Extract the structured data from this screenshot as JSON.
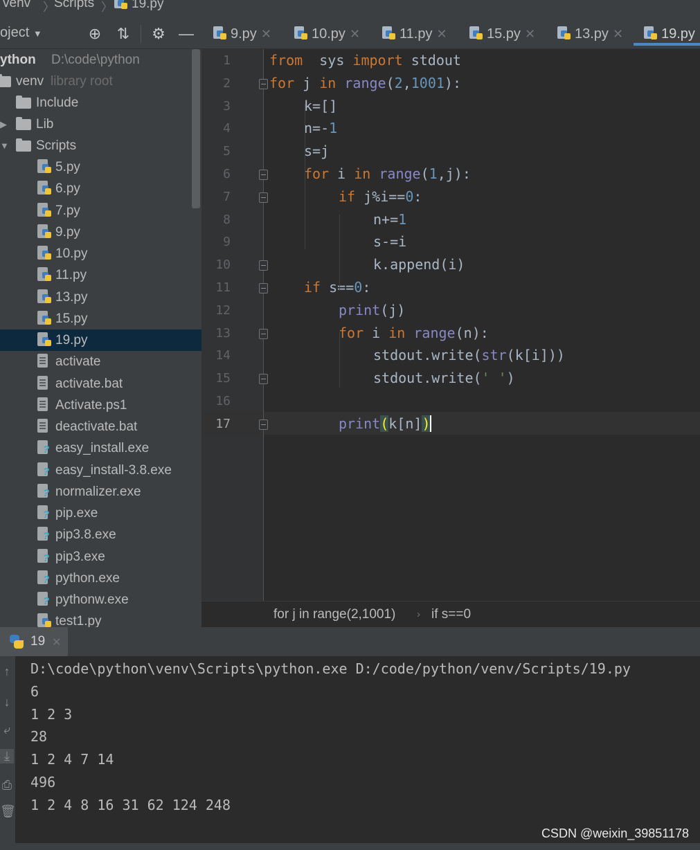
{
  "breadcrumb": {
    "items": [
      "venv",
      "Scripts",
      "19.py"
    ]
  },
  "project_toolbar": {
    "label": "oject",
    "icons": [
      "locate-icon",
      "collapse-icon",
      "gear-icon",
      "minimize-icon"
    ]
  },
  "tabs": [
    {
      "label": "9.py",
      "active": false
    },
    {
      "label": "10.py",
      "active": false
    },
    {
      "label": "11.py",
      "active": false
    },
    {
      "label": "15.py",
      "active": false
    },
    {
      "label": "13.py",
      "active": false
    },
    {
      "label": "19.py",
      "active": true
    }
  ],
  "sidebar": {
    "root": {
      "name": "ython",
      "path": "D:\\code\\python"
    },
    "venv": {
      "name": "venv",
      "hint": "library root"
    },
    "folders": [
      "Include",
      "Lib",
      "Scripts"
    ],
    "files": [
      {
        "name": "5.py",
        "kind": "python"
      },
      {
        "name": "6.py",
        "kind": "python"
      },
      {
        "name": "7.py",
        "kind": "python"
      },
      {
        "name": "9.py",
        "kind": "python"
      },
      {
        "name": "10.py",
        "kind": "python"
      },
      {
        "name": "11.py",
        "kind": "python"
      },
      {
        "name": "13.py",
        "kind": "python"
      },
      {
        "name": "15.py",
        "kind": "python"
      },
      {
        "name": "19.py",
        "kind": "python",
        "selected": true
      },
      {
        "name": "activate",
        "kind": "text"
      },
      {
        "name": "activate.bat",
        "kind": "text"
      },
      {
        "name": "Activate.ps1",
        "kind": "text"
      },
      {
        "name": "deactivate.bat",
        "kind": "text"
      },
      {
        "name": "easy_install.exe",
        "kind": "exe"
      },
      {
        "name": "easy_install-3.8.exe",
        "kind": "exe"
      },
      {
        "name": "normalizer.exe",
        "kind": "exe"
      },
      {
        "name": "pip.exe",
        "kind": "exe"
      },
      {
        "name": "pip3.8.exe",
        "kind": "exe"
      },
      {
        "name": "pip3.exe",
        "kind": "exe"
      },
      {
        "name": "python.exe",
        "kind": "exe"
      },
      {
        "name": "pythonw.exe",
        "kind": "exe"
      },
      {
        "name": "test1.py",
        "kind": "python"
      }
    ]
  },
  "editor": {
    "line_numbers": [
      "1",
      "2",
      "3",
      "4",
      "5",
      "6",
      "7",
      "8",
      "9",
      "10",
      "11",
      "12",
      "13",
      "14",
      "15",
      "16",
      "17"
    ],
    "current_line": "17",
    "lines": [
      [
        [
          "kw",
          "from"
        ],
        [
          "",
          "  sys "
        ],
        [
          "kw",
          "import"
        ],
        [
          "",
          " stdout"
        ]
      ],
      [
        [
          "kw",
          "for"
        ],
        [
          "",
          " j "
        ],
        [
          "kw",
          "in"
        ],
        [
          "",
          " "
        ],
        [
          "bi",
          "range"
        ],
        [
          "",
          "("
        ],
        [
          "num",
          "2"
        ],
        [
          "",
          ","
        ],
        [
          "num",
          "1001"
        ],
        [
          "",
          "):"
        ]
      ],
      [
        [
          "",
          "k=[]"
        ]
      ],
      [
        [
          "",
          "n=-"
        ],
        [
          "num",
          "1"
        ]
      ],
      [
        [
          "",
          "s=j"
        ]
      ],
      [
        [
          "kw",
          "for"
        ],
        [
          "",
          " i "
        ],
        [
          "kw",
          "in"
        ],
        [
          "",
          " "
        ],
        [
          "bi",
          "range"
        ],
        [
          "",
          "("
        ],
        [
          "num",
          "1"
        ],
        [
          "",
          ",j):"
        ]
      ],
      [
        [
          "kw",
          "if"
        ],
        [
          "",
          " j%i=="
        ],
        [
          "num",
          "0"
        ],
        [
          "",
          ":"
        ]
      ],
      [
        [
          "",
          "n+="
        ],
        [
          "num",
          "1"
        ]
      ],
      [
        [
          "",
          "s-=i"
        ]
      ],
      [
        [
          "",
          "k.append(i)"
        ]
      ],
      [
        [
          "kw",
          "if"
        ],
        [
          "",
          " s=="
        ],
        [
          "num",
          "0"
        ],
        [
          "",
          ":"
        ]
      ],
      [
        [
          "bi",
          "print"
        ],
        [
          "",
          "(j)"
        ]
      ],
      [
        [
          "kw",
          "for"
        ],
        [
          "",
          " i "
        ],
        [
          "kw",
          "in"
        ],
        [
          "",
          " "
        ],
        [
          "bi",
          "range"
        ],
        [
          "",
          "(n):"
        ]
      ],
      [
        [
          "",
          "stdout.write("
        ],
        [
          "bi",
          "str"
        ],
        [
          "",
          "(k[i]))"
        ]
      ],
      [
        [
          "",
          "stdout.write("
        ],
        [
          "str",
          "' '"
        ],
        [
          "",
          ")"
        ]
      ],
      [],
      [
        [
          "bi",
          "print"
        ],
        [
          "bm",
          "("
        ],
        [
          "",
          "k[n]"
        ],
        [
          "bm",
          ")"
        ]
      ]
    ]
  },
  "editor_breadcrumb": [
    "for j in range(2,1001)",
    "if s==0"
  ],
  "run_panel": {
    "tab_label": "19",
    "output": [
      "D:\\code\\python\\venv\\Scripts\\python.exe D:/code/python/venv/Scripts/19.py",
      "6",
      "1 2 3",
      "28",
      "1 2 4 7 14",
      "496",
      "1 2 4 8 16 31 62 124 248"
    ]
  },
  "watermark": "CSDN @weixin_39851178",
  "colors": {
    "keyword": "#cc7832",
    "builtin": "#8888c6",
    "number": "#6897bb",
    "string": "#6a8759",
    "selection": "#0d293e",
    "active_tab": "#4a88c7"
  }
}
